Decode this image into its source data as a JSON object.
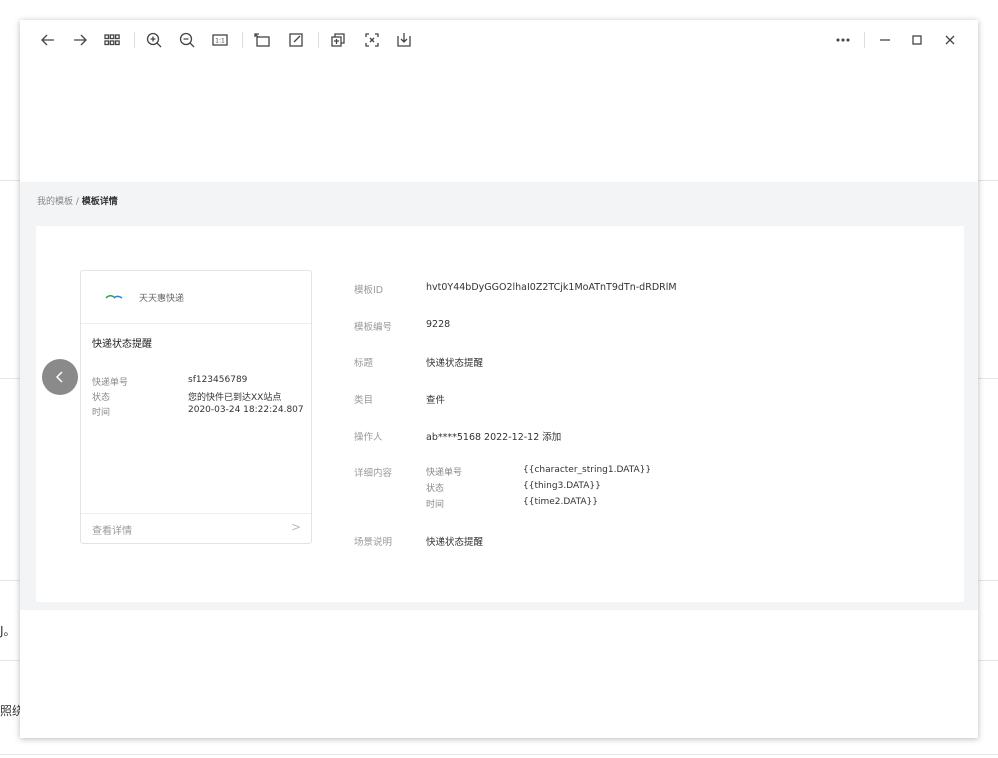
{
  "background": {
    "text_1": "J。",
    "text_2": "照绕"
  },
  "toolbar": {
    "back": "arrow-left-icon",
    "forward": "arrow-right-icon",
    "grid": "grid-icon",
    "zoom_in": "zoom-in-icon",
    "zoom_out": "zoom-out-icon",
    "actual_size": "1:1",
    "rotate": "rotate-icon",
    "edit": "edit-icon",
    "copy": "copy-icon",
    "ocr": "text-extract-icon",
    "download": "download-icon",
    "more": "more-icon",
    "minimize": "minimize-icon",
    "maximize": "maximize-icon",
    "close": "close-icon"
  },
  "breadcrumb": {
    "parent": "我的模板",
    "separator": " / ",
    "current": "模板详情"
  },
  "card": {
    "brand": "天天惠快递",
    "title": "快递状态提醒",
    "rows": [
      {
        "key": "快递单号",
        "value": "sf123456789"
      },
      {
        "key": "状态",
        "value": "您的快件已到达XX站点"
      },
      {
        "key": "时间",
        "value": "2020-03-24 18:22:24.807"
      }
    ],
    "footer_link": "查看详情",
    "footer_chevron": ">"
  },
  "details": [
    {
      "label": "模板ID",
      "value": "hvt0Y44bDyGGO2lhaI0Z2TCjk1MoATnT9dTn-dRDRlM"
    },
    {
      "label": "模板编号",
      "value": "9228"
    },
    {
      "label": "标题",
      "value": "快递状态提醒"
    },
    {
      "label": "类目",
      "value": "查件"
    },
    {
      "label": "操作人",
      "value": "ab****5168 2022-12-12 添加"
    },
    {
      "label": "详细内容",
      "value": ""
    },
    {
      "label": "场景说明",
      "value": "快递状态提醒"
    }
  ],
  "detail_content": [
    {
      "key": "快递单号",
      "value": "{{character_string1.DATA}}"
    },
    {
      "key": "状态",
      "value": "{{thing3.DATA}}"
    },
    {
      "key": "时间",
      "value": "{{time2.DATA}}"
    }
  ]
}
